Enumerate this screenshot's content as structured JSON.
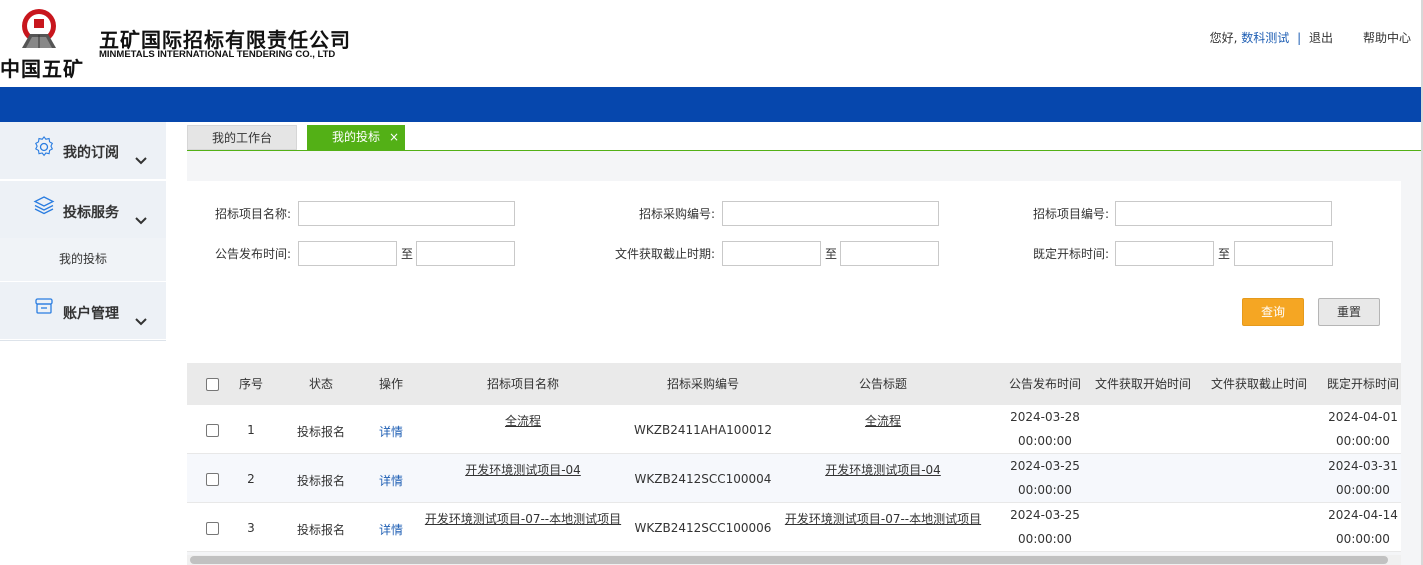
{
  "header": {
    "logo_text": "中国五矿",
    "company_cn": "五矿国际招标有限责任公司",
    "company_en": "MINMETALS INTERNATIONAL TENDERING CO., LTD",
    "greeting": "您好,",
    "username": "数科测试",
    "separator": "|",
    "logout": "退出",
    "help": "帮助中心",
    "brand_blue": "#0647ad"
  },
  "sidebar": {
    "groups": [
      {
        "label": "我的订阅",
        "icon": "gear-icon"
      },
      {
        "label": "投标服务",
        "icon": "layers-icon",
        "children": [
          {
            "label": "我的投标"
          }
        ]
      },
      {
        "label": "账户管理",
        "icon": "store-icon"
      }
    ]
  },
  "tabs": [
    {
      "label": "我的工作台",
      "active": false
    },
    {
      "label": "我的投标",
      "active": true,
      "close": "×"
    }
  ],
  "search": {
    "project_name_label": "招标项目名称:",
    "purchase_no_label": "招标采购编号:",
    "project_no_label": "招标项目编号:",
    "publish_time_label": "公告发布时间:",
    "doc_deadline_label": "文件获取截止时期:",
    "open_time_label": "既定开标时间:",
    "range_sep": "至",
    "query_label": "查询",
    "reset_label": "重置",
    "accent": "#f5a623"
  },
  "table": {
    "columns": [
      "序号",
      "状态",
      "操作",
      "招标项目名称",
      "招标采购编号",
      "公告标题",
      "公告发布时间",
      "文件获取开始时间",
      "文件获取截止时间",
      "既定开标时间"
    ],
    "rows": [
      {
        "no": "1",
        "status": "投标报名",
        "action": "详情",
        "project_name": "全流程",
        "purchase_no": "WKZB2411AHA100012",
        "title": "全流程",
        "publish_date": "2024-03-28",
        "publish_time": "00:00:00",
        "doc_start": "",
        "doc_end": "",
        "open_date": "2024-04-01",
        "open_time": "00:00:00"
      },
      {
        "no": "2",
        "status": "投标报名",
        "action": "详情",
        "project_name": "开发环境测试项目-04",
        "purchase_no": "WKZB2412SCC100004",
        "title": "开发环境测试项目-04",
        "publish_date": "2024-03-25",
        "publish_time": "00:00:00",
        "doc_start": "",
        "doc_end": "",
        "open_date": "2024-03-31",
        "open_time": "00:00:00"
      },
      {
        "no": "3",
        "status": "投标报名",
        "action": "详情",
        "project_name": "开发环境测试项目-07--本地测试项目",
        "purchase_no": "WKZB2412SCC100006",
        "title": "开发环境测试项目-07--本地测试项目",
        "publish_date": "2024-03-25",
        "publish_time": "00:00:00",
        "doc_start": "",
        "doc_end": "",
        "open_date": "2024-04-14",
        "open_time": "00:00:00"
      }
    ]
  }
}
